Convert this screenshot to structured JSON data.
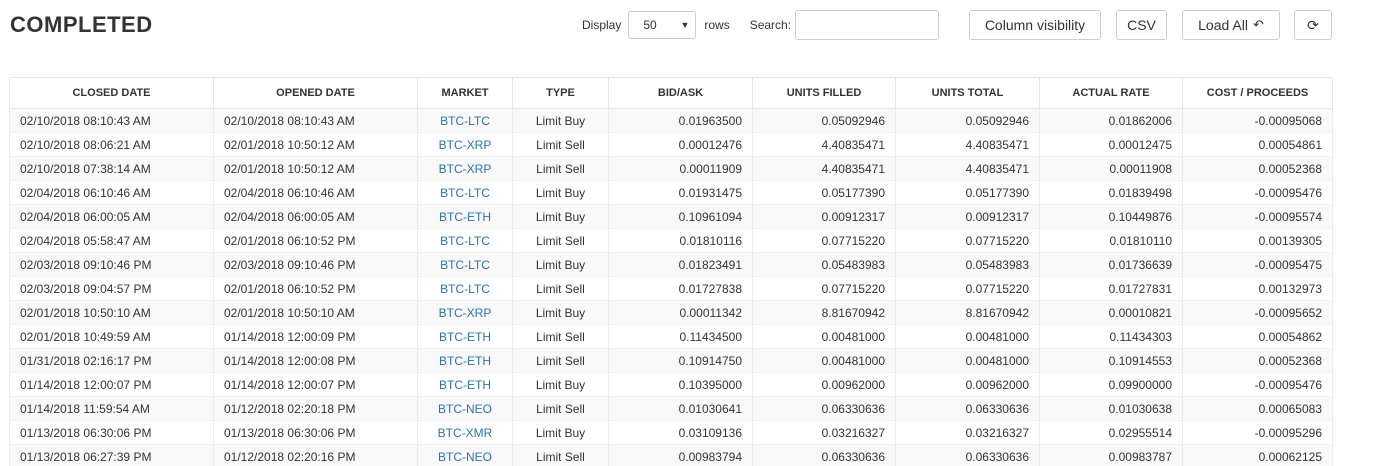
{
  "header": {
    "title": "COMPLETED",
    "display_label": "Display",
    "display_value": "50",
    "rows_label": "rows",
    "search_label": "Search:",
    "search_value": ""
  },
  "toolbar": {
    "column_visibility": "Column visibility",
    "csv": "CSV",
    "load_all": "Load All",
    "load_all_icon": "undo-icon",
    "refresh_icon": "refresh-icon"
  },
  "colors": {
    "market_link": "#2a72b5",
    "stripe": "#f9f9f9"
  },
  "table": {
    "columns": [
      "CLOSED DATE",
      "OPENED DATE",
      "MARKET",
      "TYPE",
      "BID/ASK",
      "UNITS FILLED",
      "UNITS TOTAL",
      "ACTUAL RATE",
      "COST / PROCEEDS"
    ],
    "rows": [
      [
        "02/10/2018 08:10:43 AM",
        "02/10/2018 08:10:43 AM",
        "BTC-LTC",
        "Limit Buy",
        "0.01963500",
        "0.05092946",
        "0.05092946",
        "0.01862006",
        "-0.00095068"
      ],
      [
        "02/10/2018 08:06:21 AM",
        "02/01/2018 10:50:12 AM",
        "BTC-XRP",
        "Limit Sell",
        "0.00012476",
        "4.40835471",
        "4.40835471",
        "0.00012475",
        "0.00054861"
      ],
      [
        "02/10/2018 07:38:14 AM",
        "02/01/2018 10:50:12 AM",
        "BTC-XRP",
        "Limit Sell",
        "0.00011909",
        "4.40835471",
        "4.40835471",
        "0.00011908",
        "0.00052368"
      ],
      [
        "02/04/2018 06:10:46 AM",
        "02/04/2018 06:10:46 AM",
        "BTC-LTC",
        "Limit Buy",
        "0.01931475",
        "0.05177390",
        "0.05177390",
        "0.01839498",
        "-0.00095476"
      ],
      [
        "02/04/2018 06:00:05 AM",
        "02/04/2018 06:00:05 AM",
        "BTC-ETH",
        "Limit Buy",
        "0.10961094",
        "0.00912317",
        "0.00912317",
        "0.10449876",
        "-0.00095574"
      ],
      [
        "02/04/2018 05:58:47 AM",
        "02/01/2018 06:10:52 PM",
        "BTC-LTC",
        "Limit Sell",
        "0.01810116",
        "0.07715220",
        "0.07715220",
        "0.01810110",
        "0.00139305"
      ],
      [
        "02/03/2018 09:10:46 PM",
        "02/03/2018 09:10:46 PM",
        "BTC-LTC",
        "Limit Buy",
        "0.01823491",
        "0.05483983",
        "0.05483983",
        "0.01736639",
        "-0.00095475"
      ],
      [
        "02/03/2018 09:04:57 PM",
        "02/01/2018 06:10:52 PM",
        "BTC-LTC",
        "Limit Sell",
        "0.01727838",
        "0.07715220",
        "0.07715220",
        "0.01727831",
        "0.00132973"
      ],
      [
        "02/01/2018 10:50:10 AM",
        "02/01/2018 10:50:10 AM",
        "BTC-XRP",
        "Limit Buy",
        "0.00011342",
        "8.81670942",
        "8.81670942",
        "0.00010821",
        "-0.00095652"
      ],
      [
        "02/01/2018 10:49:59 AM",
        "01/14/2018 12:00:09 PM",
        "BTC-ETH",
        "Limit Sell",
        "0.11434500",
        "0.00481000",
        "0.00481000",
        "0.11434303",
        "0.00054862"
      ],
      [
        "01/31/2018 02:16:17 PM",
        "01/14/2018 12:00:08 PM",
        "BTC-ETH",
        "Limit Sell",
        "0.10914750",
        "0.00481000",
        "0.00481000",
        "0.10914553",
        "0.00052368"
      ],
      [
        "01/14/2018 12:00:07 PM",
        "01/14/2018 12:00:07 PM",
        "BTC-ETH",
        "Limit Buy",
        "0.10395000",
        "0.00962000",
        "0.00962000",
        "0.09900000",
        "-0.00095476"
      ],
      [
        "01/14/2018 11:59:54 AM",
        "01/12/2018 02:20:18 PM",
        "BTC-NEO",
        "Limit Sell",
        "0.01030641",
        "0.06330636",
        "0.06330636",
        "0.01030638",
        "0.00065083"
      ],
      [
        "01/13/2018 06:30:06 PM",
        "01/13/2018 06:30:06 PM",
        "BTC-XMR",
        "Limit Buy",
        "0.03109136",
        "0.03216327",
        "0.03216327",
        "0.02955514",
        "-0.00095296"
      ],
      [
        "01/13/2018 06:27:39 PM",
        "01/12/2018 02:20:16 PM",
        "BTC-NEO",
        "Limit Sell",
        "0.00983794",
        "0.06330636",
        "0.06330636",
        "0.00983787",
        "0.00062125"
      ]
    ]
  }
}
